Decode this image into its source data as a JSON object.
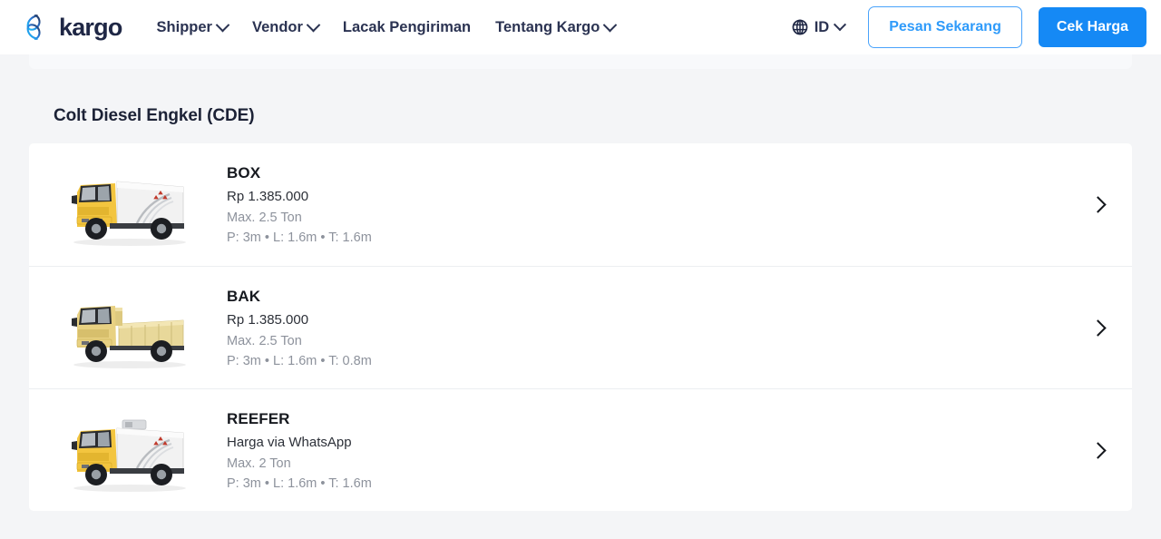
{
  "header": {
    "logo_text": "kargo",
    "logo_icon": "kargo-logo-icon",
    "nav": [
      {
        "label": "Shipper",
        "has_dropdown": true
      },
      {
        "label": "Vendor",
        "has_dropdown": true
      },
      {
        "label": "Lacak Pengiriman",
        "has_dropdown": false
      },
      {
        "label": "Tentang Kargo",
        "has_dropdown": true
      }
    ],
    "language": {
      "icon": "globe-icon",
      "label": "ID",
      "has_dropdown": true
    },
    "cta_outline": "Pesan Sekarang",
    "cta_solid": "Cek Harga",
    "colors": {
      "nav_text": "#2b3352",
      "outline_border": "#4aa3fb",
      "outline_text": "#2f9bfa",
      "solid_bg": "#1589f5",
      "solid_text": "#ffffff",
      "logo_text": "#1f2745",
      "logo_gradient_from": "#1ec8ff",
      "logo_gradient_to": "#1f2745"
    }
  },
  "main": {
    "section_title": "Colt Diesel Engkel (CDE)",
    "trucks": [
      {
        "name": "BOX",
        "price": "Rp 1.385.000",
        "capacity": "Max. 2.5 Ton",
        "dimensions": "P: 3m • L: 1.6m • T: 1.6m",
        "image": "truck-box-icon",
        "arrow": "chevron-right-icon"
      },
      {
        "name": "BAK",
        "price": "Rp 1.385.000",
        "capacity": "Max. 2.5 Ton",
        "dimensions": "P: 3m • L: 1.6m • T: 0.8m",
        "image": "truck-bak-icon",
        "arrow": "chevron-right-icon"
      },
      {
        "name": "REEFER",
        "price": "Harga via WhatsApp",
        "capacity": "Max. 2 Ton",
        "dimensions": "P: 3m • L: 1.6m • T: 1.6m",
        "image": "truck-reefer-icon",
        "arrow": "chevron-right-icon"
      }
    ],
    "colors": {
      "page_bg": "#f4f5f7",
      "card_bg": "#ffffff",
      "divider": "#eceef1",
      "title_text": "#1c2236",
      "name_text": "#16191f",
      "price_text": "#2c3038",
      "muted_text": "#8d929c"
    }
  }
}
